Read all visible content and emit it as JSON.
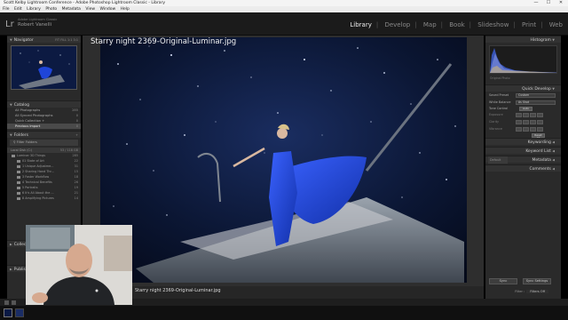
{
  "window": {
    "title": "Scott Kelby Lightroom Conference - Adobe Photoshop Lightroom Classic - Library",
    "controls": [
      "—",
      "☐",
      "✕"
    ]
  },
  "menu": [
    "File",
    "Edit",
    "Library",
    "Photo",
    "Metadata",
    "View",
    "Window",
    "Help"
  ],
  "identity": {
    "logo": "Lr",
    "subtitle": "Adobe Lightroom Classic",
    "name": "Robert Vanelli"
  },
  "modules": [
    {
      "label": "Library",
      "active": true
    },
    {
      "label": "Develop",
      "active": false
    },
    {
      "label": "Map",
      "active": false
    },
    {
      "label": "Book",
      "active": false
    },
    {
      "label": "Slideshow",
      "active": false
    },
    {
      "label": "Print",
      "active": false
    },
    {
      "label": "Web",
      "active": false
    }
  ],
  "left": {
    "navigator": {
      "title": "Navigator",
      "zoom": "FIT  FILL  1:1  3:1"
    },
    "catalog": {
      "title": "Catalog",
      "items": [
        {
          "label": "All Photographs",
          "count": "285"
        },
        {
          "label": "All Synced Photographs",
          "count": "0"
        },
        {
          "label": "Quick Collection +",
          "count": "0"
        },
        {
          "label": "Previous Import",
          "count": "0"
        }
      ]
    },
    "folders": {
      "title": "Folders",
      "filter_label": "Filter Folders",
      "volume": {
        "label": "Local Disk (C:)",
        "size": "53 / 118 GB"
      },
      "items": [
        {
          "label": "Luminar 3D Things",
          "count": "285"
        },
        {
          "label": "01 State of Art",
          "count": "22"
        },
        {
          "label": "1 Unique Adjustme...",
          "count": "31"
        },
        {
          "label": "2 Sharing Hand Thr...",
          "count": "15"
        },
        {
          "label": "3 Faster Workflow",
          "count": "18"
        },
        {
          "label": "4 Technical Benefits",
          "count": "26"
        },
        {
          "label": "5 Portraits",
          "count": "19"
        },
        {
          "label": "6 It's All About the ...",
          "count": "21"
        },
        {
          "label": "8 Amplifying Pictures",
          "count": "14"
        }
      ]
    },
    "collections_title": "Collections",
    "publish_title": "Publish Services"
  },
  "right": {
    "histogram": {
      "title": "Histogram",
      "label": "Original Photo"
    },
    "quick_develop": {
      "title": "Quick Develop",
      "rows": [
        {
          "label": "Saved Preset",
          "value": "Custom"
        },
        {
          "label": "White Balance",
          "value": "As Shot"
        }
      ],
      "tone_label": "Tone Control",
      "tone_button": "Auto",
      "tone_rows": [
        "Exposure",
        "Clarity",
        "Vibrance"
      ],
      "reset_label": "Reset All"
    },
    "panels": [
      "Keywording",
      "Keyword List",
      "Metadata",
      "Comments"
    ],
    "metadata_preset": "Default"
  },
  "canvas": {
    "filename": "Starry night 2369-Original-Luminar.jpg"
  },
  "toolbar": {
    "filename": "Starry night 2369-Original-Luminar.jpg",
    "sync_label": "Sync",
    "sync_settings_label": "Sync Settings",
    "filter_label": "Filter :",
    "filter_value": "Filters Off"
  },
  "colors": {
    "panel": "#2a2a2a",
    "background": "#2e2e2e",
    "sky": "#0b1633",
    "dress": "#1e3fd0"
  }
}
